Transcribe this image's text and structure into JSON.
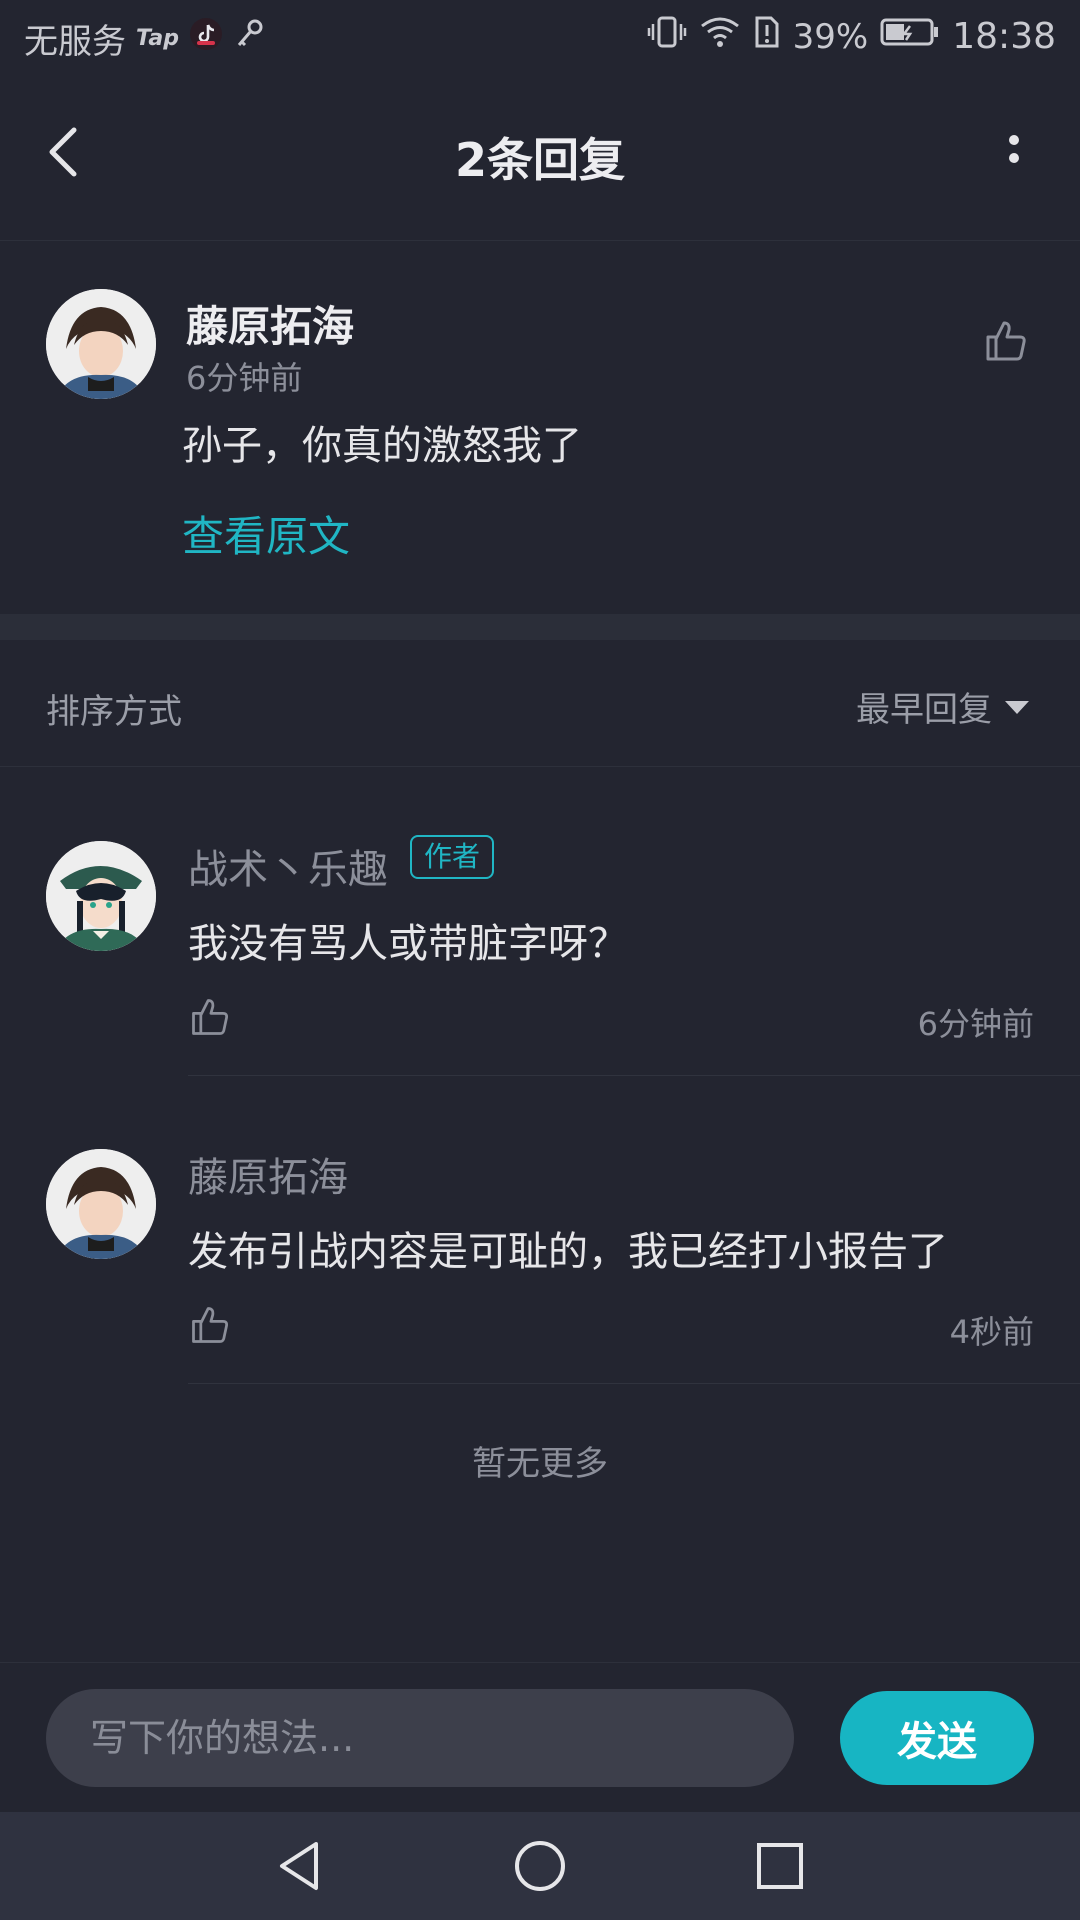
{
  "status_bar": {
    "carrier": "无服务",
    "tap_label": "Tap",
    "battery": "39%",
    "time": "18:38"
  },
  "header": {
    "title": "2条回复"
  },
  "main_comment": {
    "author": "藤原拓海",
    "time": "6分钟前",
    "text": "孙子，你真的激怒我了",
    "view_original": "查看原文"
  },
  "sort": {
    "label": "排序方式",
    "selected": "最早回复"
  },
  "replies": [
    {
      "author": "战术丶乐趣",
      "badge": "作者",
      "text": "我没有骂人或带脏字呀？",
      "time": "6分钟前"
    },
    {
      "author": "藤原拓海",
      "text": "发布引战内容是可耻的，我已经打小报告了",
      "time": "4秒前"
    }
  ],
  "no_more": "暂无更多",
  "composer": {
    "placeholder": "写下你的想法...",
    "send_label": "发送"
  },
  "colors": {
    "background": "#232530",
    "accent": "#17b5c3"
  }
}
